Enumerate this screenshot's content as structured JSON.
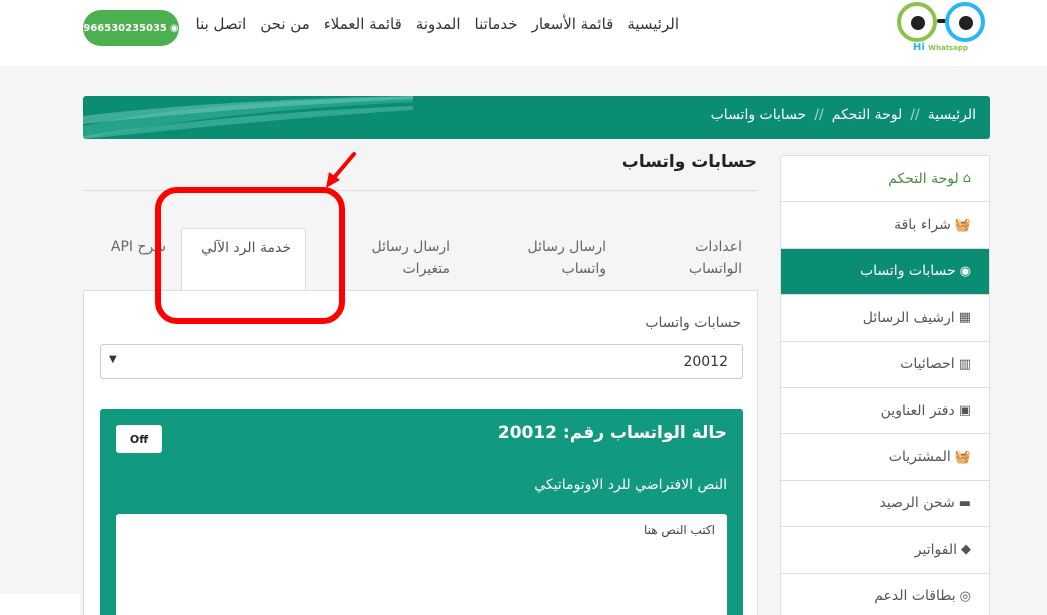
{
  "logo": {
    "text_main": "Hi",
    "text_sub": "Whatsapp"
  },
  "nav": {
    "items": [
      "الرئيسية",
      "قائمة الأسعار",
      "خدماتنا",
      "المدونة",
      "قائمة العملاء",
      "من نحن",
      "اتصل بنا"
    ],
    "phone": "966530235035"
  },
  "breadcrumb": {
    "items": [
      "الرئيسية",
      "لوحة التحكم",
      "حسابات واتساب"
    ],
    "separator": "//"
  },
  "sidebar": {
    "items": [
      {
        "label": "لوحة التحكم",
        "icon": "home-icon",
        "glyph": "⌂"
      },
      {
        "label": "شراء باقة",
        "icon": "basket-icon",
        "glyph": "🧺"
      },
      {
        "label": "حسابات واتساب",
        "icon": "whatsapp-icon",
        "glyph": "◉",
        "active": true
      },
      {
        "label": "ارشيف الرسائل",
        "icon": "archive-icon",
        "glyph": "▦"
      },
      {
        "label": "احصائيات",
        "icon": "chart-icon",
        "glyph": "▥"
      },
      {
        "label": "دفتر العناوين",
        "icon": "address-book-icon",
        "glyph": "▣"
      },
      {
        "label": "المشتريات",
        "icon": "basket-icon",
        "glyph": "🧺"
      },
      {
        "label": "شحن الرصيد",
        "icon": "credit-card-icon",
        "glyph": "▬"
      },
      {
        "label": "الفواتير",
        "icon": "tag-icon",
        "glyph": "◆"
      },
      {
        "label": "بطاقات الدعم",
        "icon": "life-ring-icon",
        "glyph": "◎"
      }
    ]
  },
  "page": {
    "title": "حسابات واتساب"
  },
  "tabs": [
    {
      "label": "اعدادات الواتساب"
    },
    {
      "label": "ارسال رسائل واتساب"
    },
    {
      "label": "ارسال رسائل متغيرات"
    },
    {
      "label": "خدمة الرد الآلي",
      "active": true
    },
    {
      "label": "شرح API"
    }
  ],
  "form": {
    "accounts_label": "حسابات واتساب",
    "selected_account": "20012"
  },
  "status": {
    "title": "حالة الواتساب رقم: 20012",
    "toggle_label": "Off",
    "default_text_label": "النص الافتراضي للرد الاوتوماتيكي",
    "textarea_placeholder": "اكتب النص هنا"
  },
  "colors": {
    "primary": "#0b8d74",
    "card": "#129a80",
    "phone_button": "#4caf50",
    "annotation": "#ff0000"
  }
}
